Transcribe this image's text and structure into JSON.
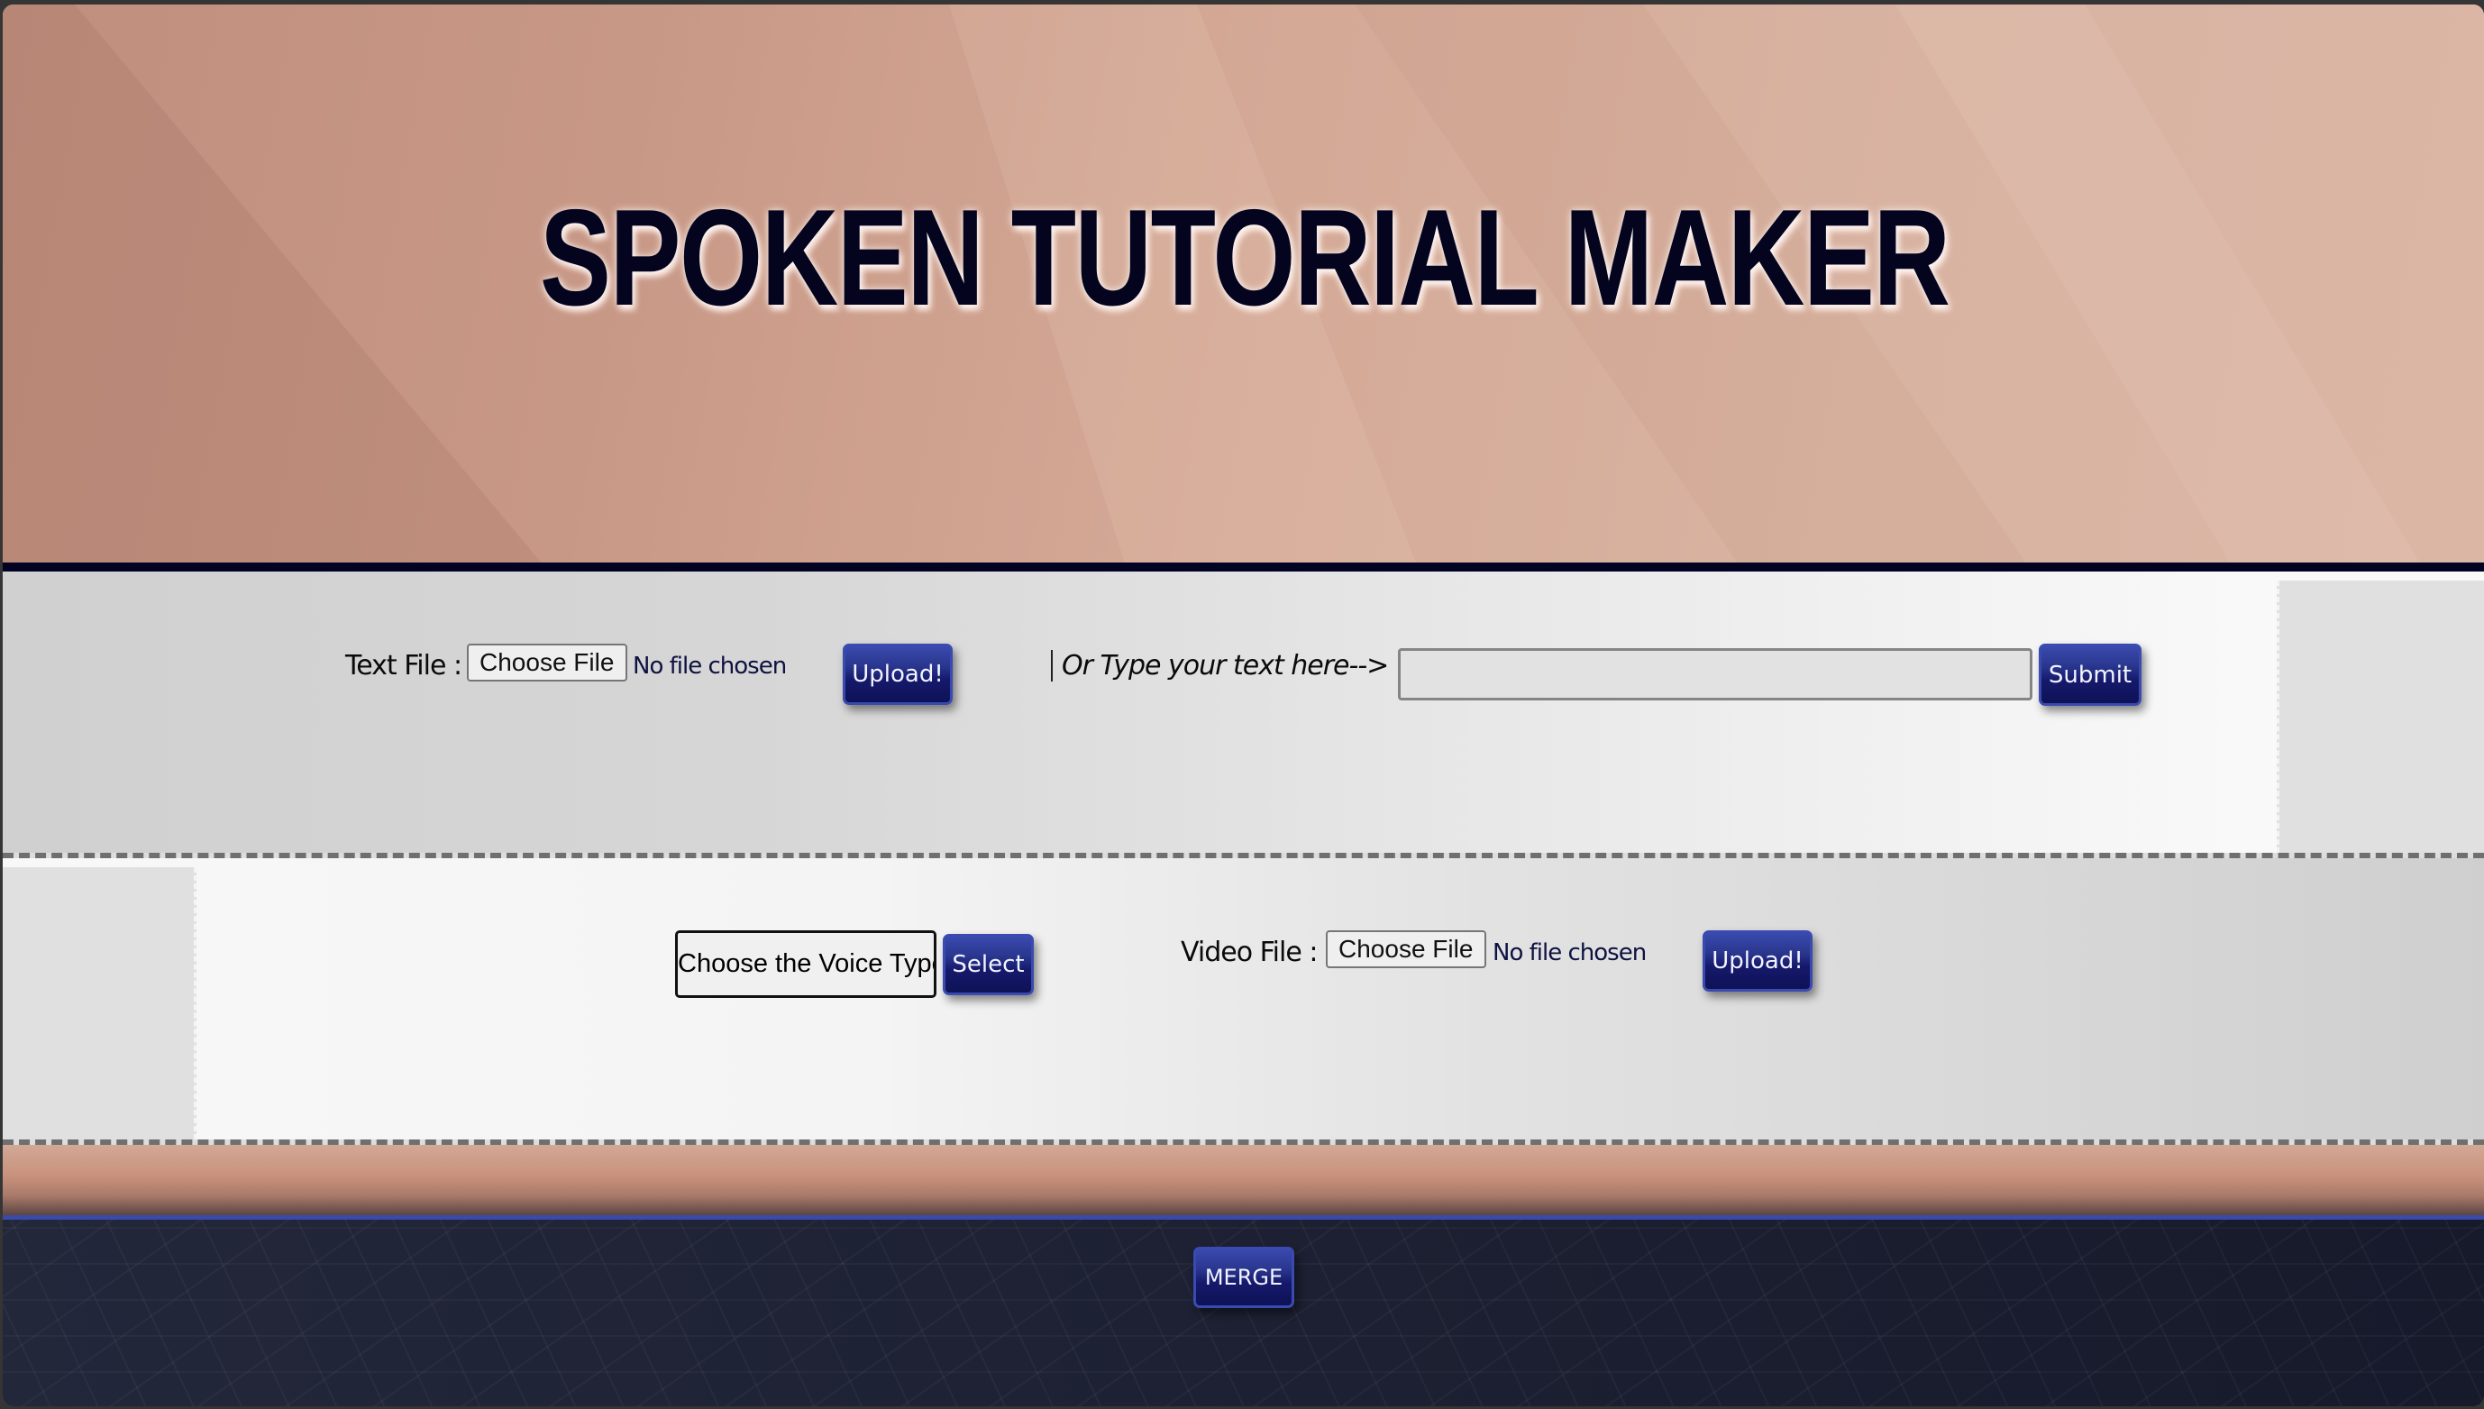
{
  "header": {
    "title": "SPOKEN TUTORIAL MAKER"
  },
  "text_upload": {
    "label": "Text File :",
    "choose_file_label": "Choose File",
    "file_status": "No file chosen",
    "upload_label": "Upload!"
  },
  "text_entry": {
    "prompt": "Or Type your text here-->",
    "input_value": "",
    "input_placeholder": "",
    "submit_label": "Submit"
  },
  "voice": {
    "selected": "Choose the Voice Type:",
    "select_label": "Select"
  },
  "video_upload": {
    "label": "Video File :",
    "choose_file_label": "Choose File",
    "file_status": "No file chosen",
    "upload_label": "Upload!"
  },
  "footer": {
    "merge_label": "MERGE"
  },
  "colors": {
    "title": "#04041f",
    "button_top": "#3a4aae",
    "button_bottom": "#0e1256",
    "file_status": "#0e1240",
    "accent_line": "#3b4aa8",
    "footer_bg": "#1e2232"
  }
}
